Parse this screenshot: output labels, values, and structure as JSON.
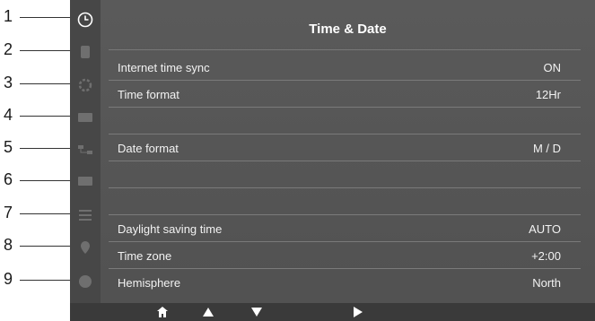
{
  "callouts": [
    "1",
    "2",
    "3",
    "4",
    "5",
    "6",
    "7",
    "8",
    "9"
  ],
  "screen": {
    "title": "Time & Date",
    "rows": [
      {
        "label": "Internet time sync",
        "value": "ON"
      },
      {
        "label": "Time format",
        "value": "12Hr"
      },
      {
        "label": "",
        "value": ""
      },
      {
        "label": "Date format",
        "value": "M / D"
      },
      {
        "label": "",
        "value": ""
      },
      {
        "label": "",
        "value": ""
      },
      {
        "label": "Daylight saving time",
        "value": "AUTO"
      },
      {
        "label": "Time zone",
        "value": "+2:00"
      },
      {
        "label": "Hemisphere",
        "value": "North"
      }
    ]
  },
  "sidebar_icons": [
    "clock-icon",
    "device-icon",
    "gear-icon",
    "keyboard-icon",
    "network-icon",
    "display-icon",
    "settings-icon",
    "location-icon",
    "globe-icon"
  ],
  "bottom_nav": [
    "home-icon",
    "up-arrow-icon",
    "down-arrow-icon",
    "right-arrow-icon"
  ],
  "colors": {
    "screen": "#555555",
    "text": "#ffffff",
    "accent": "#ffffff"
  }
}
